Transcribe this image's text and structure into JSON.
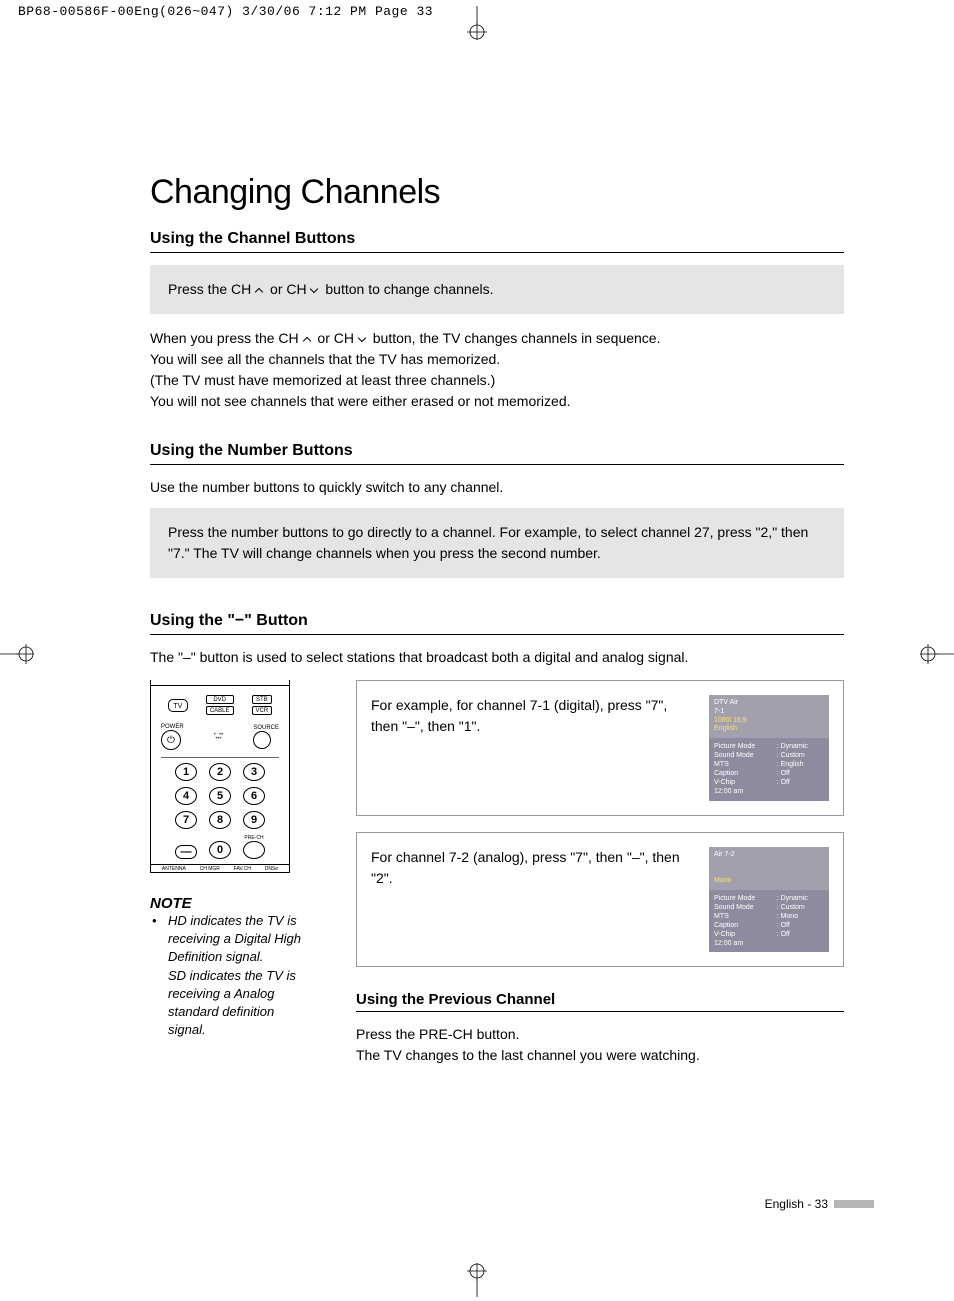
{
  "header_bar": "BP68-00586F-00Eng(026~047)  3/30/06  7:12 PM  Page 33",
  "title": "Changing Channels",
  "sec1": {
    "heading": "Using the Channel Buttons",
    "box_pre": "Press the CH ",
    "box_mid": " or CH ",
    "box_post": " button to change channels.",
    "para": "When you press the CH       or CH       button, the TV changes channels in sequence.\nYou will see all the channels that the TV has memorized.\n(The TV must have memorized at least three channels.)\nYou will not see channels that were either erased or not memorized.",
    "para_pre": "When you press the CH ",
    "para_mid": " or CH ",
    "para_post": " button, the TV changes channels in sequence.",
    "para_l2": "You will see all the channels that the TV has memorized.",
    "para_l3": "(The TV must have memorized at least three channels.)",
    "para_l4": "You will not see channels that were either erased or not memorized."
  },
  "sec2": {
    "heading": "Using the Number Buttons",
    "intro": "Use the number buttons to quickly switch to any channel.",
    "box": "Press the number buttons to go directly to a channel. For example, to select channel 27, press \"2,\" then \"7.\" The TV will change channels when you press the second number."
  },
  "sec3": {
    "heading": "Using the \"−\" Button",
    "intro": "The \"–\" button is used to select stations that broadcast both a digital and analog signal.",
    "ex1": "For example, for channel 7-1 (digital), press \"7\", then \"–\", then \"1\".",
    "ex2": "For channel 7-2 (analog), press \"7\", then \"–\", then \"2\"."
  },
  "remote": {
    "tv": "TV",
    "dvd": "DVD",
    "stb": "STB",
    "cable": "CABLE",
    "vcr": "VCR",
    "power": "POWER",
    "source": "SOURCE",
    "nums": [
      "1",
      "2",
      "3",
      "4",
      "5",
      "6",
      "7",
      "8",
      "9",
      "—",
      "0"
    ],
    "prech": "PRE-CH",
    "bottom": [
      "ANTENNA",
      "CH MGR",
      "FAV.CH",
      "DNSe"
    ]
  },
  "note": {
    "heading": "NOTE",
    "body": "HD indicates the TV is receiving a Digital High Definition signal.\nSD indicates the TV is receiving a Analog standard definition signal."
  },
  "osd1": {
    "line1": "DTV Air",
    "line2": "7-1",
    "ylabel1": "1080i 16:9",
    "ylabel2": "English",
    "rows": [
      [
        "Picture Mode",
        ": Dynamic"
      ],
      [
        "Sound Mode",
        ": Custom"
      ],
      [
        "MTS",
        ": English"
      ],
      [
        "Caption",
        ": Off"
      ],
      [
        "V-Chip",
        ": Off"
      ],
      [
        "12:00 am",
        ""
      ]
    ]
  },
  "osd2": {
    "line1": "Air 7-2",
    "line2": "",
    "ylabel1": "",
    "ylabel2": "Mono",
    "rows": [
      [
        "Picture Mode",
        ": Dynamic"
      ],
      [
        "Sound Mode",
        ": Custom"
      ],
      [
        "MTS",
        ": Mono"
      ],
      [
        "Caption",
        ": Off"
      ],
      [
        "V-Chip",
        ": Off"
      ],
      [
        "12:00 am",
        ""
      ]
    ]
  },
  "sec4": {
    "heading": "Using the Previous Channel",
    "l1": "Press the PRE-CH button.",
    "l2": "The TV changes to the last channel you were watching."
  },
  "footer": "English - 33"
}
